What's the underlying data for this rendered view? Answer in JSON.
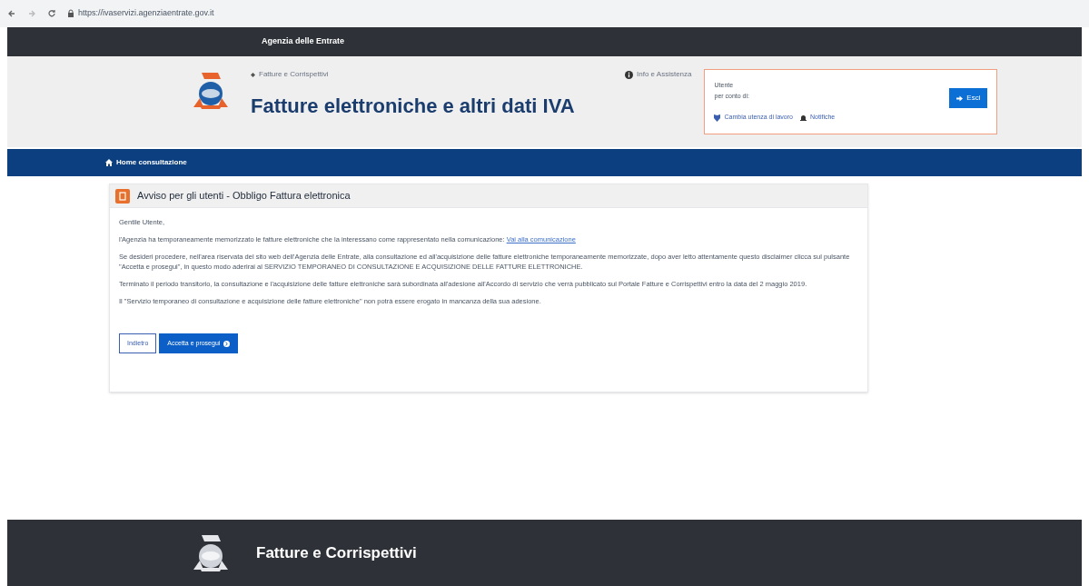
{
  "browser": {
    "url": "https://ivaservizi.agenziaentrate.gov.it"
  },
  "top_bar": {
    "title": "Agenzia delle Entrate"
  },
  "header": {
    "breadcrumb": "Fatture e Corrispettivi",
    "title": "Fatture elettroniche e altri dati IVA",
    "help_link": "Info e Assistenza",
    "user_box": {
      "user_label": "Utente",
      "on_behalf_label": "per conto di:",
      "change_user_link": "Cambia utenza di lavoro",
      "notifications_link": "Notifiche",
      "logout_button": "Esci"
    }
  },
  "nav": {
    "home_link": "Home consultazione"
  },
  "notice": {
    "title": "Avviso per gli utenti - Obbligo Fattura elettronica",
    "paragraphs": [
      {
        "text": "Gentile Utente,"
      },
      {
        "text": "l'Agenzia ha temporaneamente memorizzato le fatture elettroniche che la interessano come rappresentato nella comunicazione:",
        "link": "Vai alla comunicazione"
      },
      {
        "text": "Se desideri procedere, nell'area riservata del sito web dell'Agenzia delle Entrate, alla consultazione ed all'acquisizione delle fatture elettroniche temporaneamente memorizzate, dopo aver letto attentamente questo disclaimer clicca sul pulsante \"Accetta e prosegui\", in questo modo aderirai al SERVIZIO TEMPORANEO DI CONSULTAZIONE E ACQUISIZIONE DELLE FATTURE ELETTRONICHE."
      },
      {
        "text": "Terminato il periodo transitorio, la consultazione e l'acquisizione delle fatture elettroniche sarà subordinata all'adesione all'Accordo di servizio che verrà pubblicato sul Portale Fatture e Corrispettivi entro la data del 2 maggio 2019."
      },
      {
        "text": "Il \"Servizio temporaneo di consultazione e acquisizione delle fatture elettroniche\" non potrà essere erogato in mancanza della sua adesione."
      }
    ],
    "buttons": [
      {
        "label": "Indietro",
        "kind": "secondary"
      },
      {
        "label": "Accetta e prosegui",
        "kind": "primary"
      }
    ]
  },
  "footer": {
    "title": "Fatture e Corrispettivi"
  }
}
